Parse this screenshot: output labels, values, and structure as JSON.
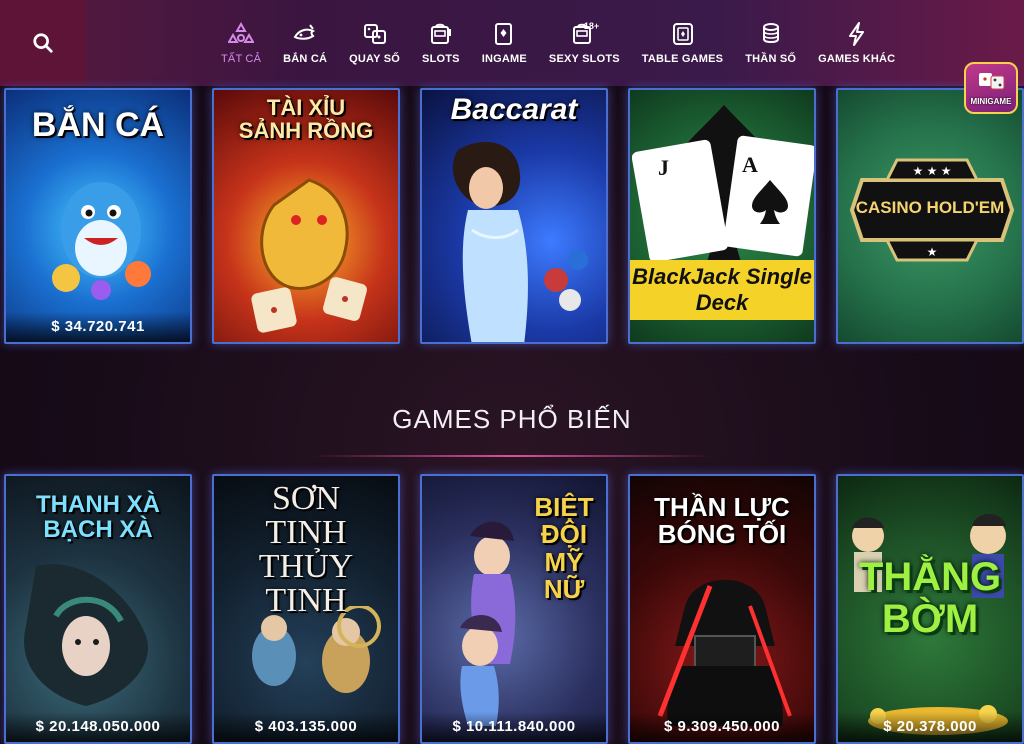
{
  "colors": {
    "accent": "#d48be8",
    "card_border": "#4a6fd0",
    "topbar_left": "#5d1436"
  },
  "search": {
    "icon": "search-icon"
  },
  "nav": {
    "items": [
      {
        "label": "TẤT CẢ",
        "icon": "all-games-icon",
        "active": true
      },
      {
        "label": "BẮN CÁ",
        "icon": "fish-icon",
        "active": false
      },
      {
        "label": "QUAY SỐ",
        "icon": "dice-icon",
        "active": false
      },
      {
        "label": "SLOTS",
        "icon": "slot-machine-icon",
        "active": false
      },
      {
        "label": "INGAME",
        "icon": "cards-icon",
        "active": false
      },
      {
        "label": "SEXY SLOTS",
        "icon": "adult-slot-icon",
        "active": false
      },
      {
        "label": "TABLE GAMES",
        "icon": "table-cards-icon",
        "active": false
      },
      {
        "label": "THẦN SỐ",
        "icon": "coin-stack-icon",
        "active": false
      },
      {
        "label": "GAMES KHÁC",
        "icon": "lightning-icon",
        "active": false
      }
    ],
    "badge_18": "18+"
  },
  "minigame": {
    "label": "MINIGAME"
  },
  "row1": [
    {
      "title": "BẮN CÁ",
      "jackpot": "$ 34.720.741",
      "theme": "ocean"
    },
    {
      "title": "TÀI XỈU SẢNH RỒNG",
      "jackpot": "",
      "theme": "dragon"
    },
    {
      "title": "Baccarat",
      "jackpot": "",
      "theme": "baccarat"
    },
    {
      "title": "BlackJack Single Deck",
      "jackpot": "",
      "theme": "blackjack"
    },
    {
      "title": "CASINO HOLD'EM",
      "jackpot": "",
      "theme": "holdem"
    }
  ],
  "popular": {
    "heading": "GAMES PHỔ BIẾN"
  },
  "row2": [
    {
      "title": "THANH XÀ BẠCH XÀ",
      "jackpot": "$ 20.148.050.000",
      "theme": "snake"
    },
    {
      "title": "SƠN TINH THỦY TINH",
      "jackpot": "$ 403.135.000",
      "theme": "legend"
    },
    {
      "title": "BIỆT ĐỘI MỸ NỮ",
      "jackpot": "$ 10.111.840.000",
      "theme": "squad"
    },
    {
      "title": "THẦN LỰC BÓNG TỐI",
      "jackpot": "$ 9.309.450.000",
      "theme": "dark"
    },
    {
      "title": "THẰNG BỜM",
      "jackpot": "$ 20.378.000",
      "theme": "bom"
    }
  ]
}
